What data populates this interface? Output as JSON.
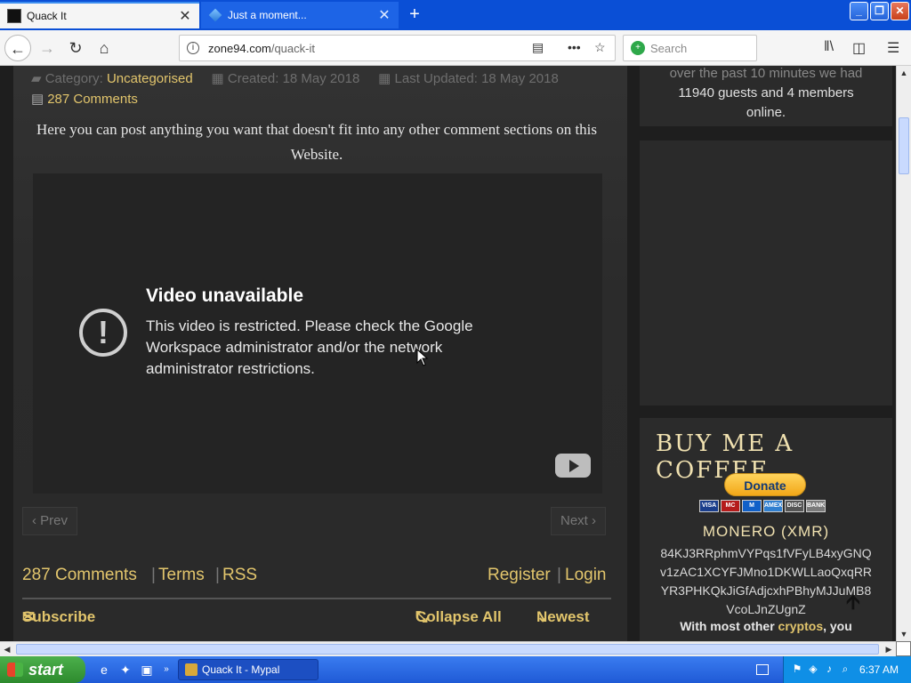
{
  "browser": {
    "tabs": [
      {
        "title": "Quack It",
        "active": true
      },
      {
        "title": "Just a moment...",
        "active": false
      }
    ],
    "new_tab_label": "+",
    "url_domain": "zone94.com",
    "url_path": "/quack-it",
    "search_placeholder": "Search"
  },
  "article": {
    "category_label": "Category:",
    "category": "Uncategorised",
    "created": "Created: 18 May 2018",
    "updated": "Last Updated: 18 May 2018",
    "comments_link": "287 Comments",
    "intro": "Here you can post anything you want that doesn't fit into any other comment sections on this Website.",
    "video": {
      "title": "Video unavailable",
      "message": "This video is restricted. Please check the Google Workspace administrator and/or the network administrator restrictions."
    },
    "prev_label": "‹ Prev",
    "next_label": "Next ›"
  },
  "comments_bar": {
    "count": "287 Comments",
    "terms": "Terms",
    "rss": "RSS",
    "register": "Register",
    "login": "Login",
    "subscribe": "Subscribe",
    "collapse_all": "Collapse All",
    "newest": "Newest"
  },
  "sidebar": {
    "online_partial": "over the past 10 minutes we had",
    "online_text": "11940 guests and 4 members online.",
    "coffee_heading": "BUY ME A COFFEE",
    "donate_label": "Donate",
    "cards": [
      "VISA",
      "MC",
      "M",
      "AMEX",
      "DISC",
      "BANK"
    ],
    "xmr_heading": "MONERO (XMR)",
    "xmr_address": "84KJ3RRphmVYPqs1fVFyLB4xyGNQv1zAC1XCYFJMno1DKWLLaoQxqRRYR3PHKQkJiGfAdjcxhPBhyMJJuMB8VcoLJnZUgnZ",
    "xmr_note_prefix": "With most other",
    "xmr_note_hl": "cryptos",
    "xmr_note_suffix": ", you"
  },
  "taskbar": {
    "start_label": "start",
    "task_item": "Quack It - Mypal",
    "clock": "6:37 AM"
  }
}
